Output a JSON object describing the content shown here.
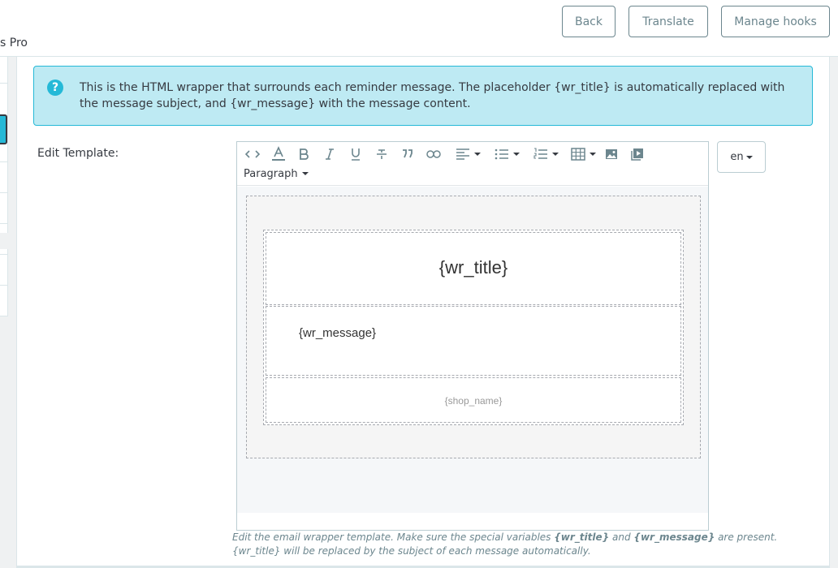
{
  "header": {
    "page_title_fragment": "s Pro",
    "buttons": {
      "back": "Back",
      "translate": "Translate",
      "manage_hooks": "Manage hooks"
    }
  },
  "alert": {
    "icon": "question-circle-icon",
    "text": "This is the HTML wrapper that surrounds each reminder message. The placeholder {wr_title} is automatically replaced with the message subject, and {wr_message} with the message content."
  },
  "form": {
    "label": "Edit Template:",
    "language": "en"
  },
  "editor": {
    "toolbar": [
      "code-icon",
      "text-color-icon",
      "bold-icon",
      "italic-icon",
      "underline-icon",
      "strikethrough-icon",
      "blockquote-icon",
      "link-icon",
      "align-icon",
      "bullet-list-icon",
      "numbered-list-icon",
      "table-icon",
      "image-icon",
      "media-icon"
    ],
    "format_select": "Paragraph",
    "content": {
      "title": "{wr_title}",
      "message": "{wr_message}",
      "footer": "{shop_name}"
    }
  },
  "help": {
    "part1": "Edit the email wrapper template. Make sure the special variables ",
    "var1": "{wr_title}",
    "part2": " and ",
    "var2": "{wr_message}",
    "part3": " are present. {wr_title} will be replaced by the subject of each message automatically."
  },
  "colors": {
    "accent": "#25b9d7",
    "alert_bg": "#beeaf3",
    "text": "#363a41",
    "muted": "#6c868e"
  }
}
